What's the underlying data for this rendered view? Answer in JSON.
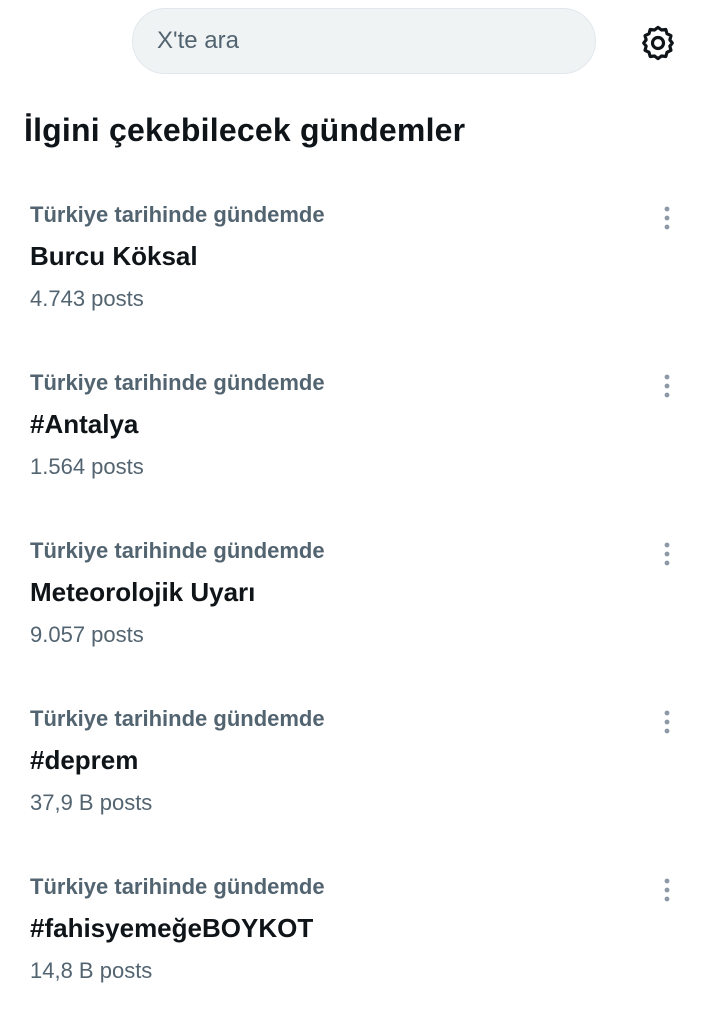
{
  "search": {
    "placeholder": "X'te ara",
    "icon": "settings-gear-icon"
  },
  "section": {
    "title": "İlgini çekebilecek gündemler"
  },
  "trends": [
    {
      "context": "Türkiye tarihinde gündemde",
      "name": "Burcu Köksal",
      "count": "4.743 posts"
    },
    {
      "context": "Türkiye tarihinde gündemde",
      "name": "#Antalya",
      "count": "1.564 posts"
    },
    {
      "context": "Türkiye tarihinde gündemde",
      "name": "Meteorolojik Uyarı",
      "count": "9.057 posts"
    },
    {
      "context": "Türkiye tarihinde gündemde",
      "name": "#deprem",
      "count": "37,9 B posts"
    },
    {
      "context": "Türkiye tarihinde gündemde",
      "name": "#fahisyemeğeBOYKOT",
      "count": "14,8 B posts"
    }
  ],
  "colors": {
    "primary_text": "#0f1419",
    "secondary_text": "#536471",
    "search_background": "#eff3f4"
  }
}
